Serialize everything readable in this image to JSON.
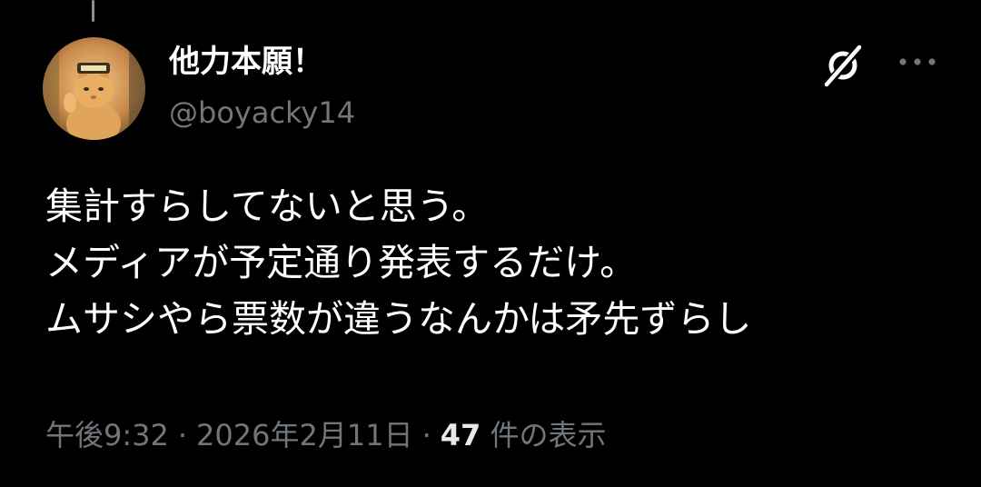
{
  "tweet": {
    "author": {
      "display_name": "他力本願！",
      "handle": "@boyacky14",
      "avatar_icon": "cat-photo-avatar"
    },
    "lines": [
      "集計すらしてないと思う。",
      "メディアが予定通り発表するだけ。",
      "ムサシやら票数が違うなんかは矛先ずらし"
    ],
    "time": "午後9:32",
    "separator": "·",
    "date": "2026年2月11日",
    "views_count": "47",
    "views_label": "件の表示"
  },
  "icons": {
    "grok": "grok-icon",
    "more": "more-options-icon"
  },
  "colors": {
    "background": "#000000",
    "primary_text": "#ffffff",
    "secondary_text": "#71767b"
  }
}
